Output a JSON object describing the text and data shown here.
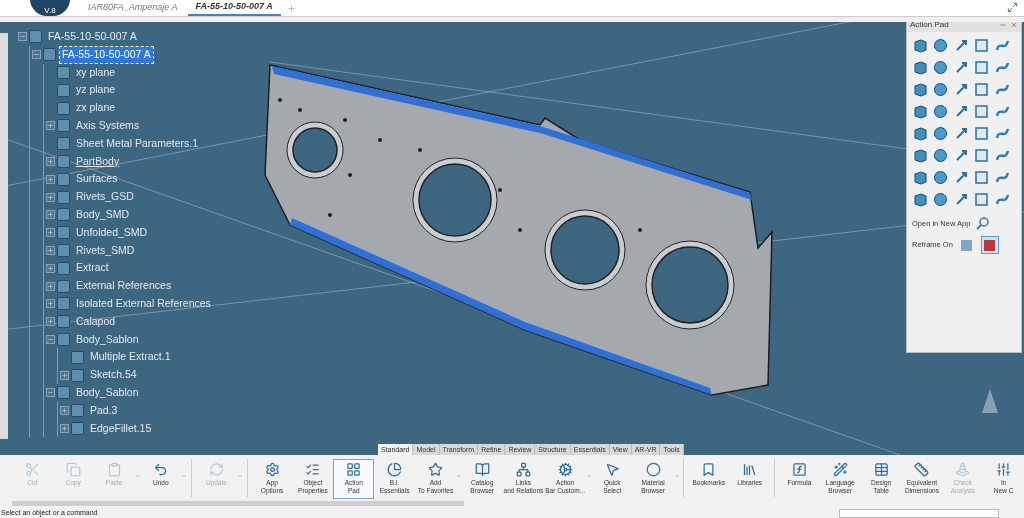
{
  "logo": {
    "text": "V.8"
  },
  "document_tabs": [
    {
      "label": "IAR80FA_Ampenaje A",
      "selected": false
    },
    {
      "label": "FA-55-10-50-007 A",
      "selected": true
    }
  ],
  "tree": [
    {
      "label": "FA-55-10-50-007 A",
      "expanded": true,
      "selected": false,
      "in_work": false,
      "children": [
        {
          "label": "FA-55-10-50-007 A",
          "expanded": true,
          "selected": true,
          "in_work": false,
          "children": [
            {
              "label": "xy plane",
              "selected": false,
              "in_work": false
            },
            {
              "label": "yz plane",
              "selected": false,
              "in_work": false
            },
            {
              "label": "zx plane",
              "selected": false,
              "in_work": false
            },
            {
              "label": "Axis Systems",
              "expanded": false,
              "selected": false,
              "in_work": false
            },
            {
              "label": "Sheet Metal Parameters.1",
              "selected": false,
              "in_work": false
            },
            {
              "label": "PartBody",
              "expanded": false,
              "selected": false,
              "in_work": true
            },
            {
              "label": "Surfaces",
              "expanded": false,
              "selected": false,
              "in_work": false
            },
            {
              "label": "Rivets_GSD",
              "expanded": false,
              "selected": false,
              "in_work": false
            },
            {
              "label": "Body_SMD",
              "expanded": false,
              "selected": false,
              "in_work": false
            },
            {
              "label": "Unfolded_SMD",
              "expanded": false,
              "selected": false,
              "in_work": false
            },
            {
              "label": "Rivets_SMD",
              "expanded": false,
              "selected": false,
              "in_work": false
            },
            {
              "label": "Extract",
              "expanded": false,
              "selected": false,
              "in_work": false
            },
            {
              "label": "External References",
              "expanded": false,
              "selected": false,
              "in_work": false
            },
            {
              "label": "Isolated External References",
              "expanded": false,
              "selected": false,
              "in_work": false
            },
            {
              "label": "Calapod",
              "expanded": false,
              "selected": false,
              "in_work": false
            },
            {
              "label": "Body_Sablon",
              "expanded": true,
              "selected": false,
              "in_work": false,
              "children": [
                {
                  "label": "Multiple Extract.1",
                  "selected": false,
                  "in_work": false
                },
                {
                  "label": "Sketch.54",
                  "expanded": false,
                  "selected": false,
                  "in_work": false
                }
              ]
            },
            {
              "label": "Body_Sablon",
              "expanded": true,
              "selected": false,
              "in_work": false,
              "children": [
                {
                  "label": "Pad.3",
                  "expanded": false,
                  "selected": false,
                  "in_work": false
                },
                {
                  "label": "EdgeFillet.15",
                  "expanded": false,
                  "selected": false,
                  "in_work": false
                }
              ]
            }
          ]
        }
      ]
    }
  ],
  "action_pad": {
    "title": "Action Pad",
    "open_in_new_app": "Open in New App",
    "reframe_on": "Reframe On",
    "reframe_buttons": [
      {
        "selected": false
      },
      {
        "selected": true
      }
    ]
  },
  "section_tabs": [
    {
      "label": "Standard",
      "selected": true
    },
    {
      "label": "Model",
      "selected": false
    },
    {
      "label": "Transform",
      "selected": false
    },
    {
      "label": "Refine",
      "selected": false
    },
    {
      "label": "Review",
      "selected": false
    },
    {
      "label": "Structure",
      "selected": false
    },
    {
      "label": "Essentials",
      "selected": false
    },
    {
      "label": "View",
      "selected": false
    },
    {
      "label": "AR-VR",
      "selected": false
    },
    {
      "label": "Tools",
      "selected": false
    }
  ],
  "toolbar": [
    {
      "label": "Cut",
      "disabled": true,
      "selected": false
    },
    {
      "label": "Copy",
      "disabled": true,
      "selected": false
    },
    {
      "label": "Paste",
      "disabled": true,
      "selected": false,
      "dropdown": true
    },
    {
      "label": "Undo",
      "disabled": false,
      "selected": false,
      "dropdown": true,
      "separator": true
    },
    {
      "label": "Update",
      "disabled": true,
      "selected": false,
      "dropdown": true,
      "separator": true
    },
    {
      "label": "App\nOptions",
      "disabled": false,
      "selected": false
    },
    {
      "label": "Object\nProperties",
      "disabled": false,
      "selected": false
    },
    {
      "label": "Action\nPad",
      "disabled": false,
      "selected": true
    },
    {
      "label": "B.I.\nEssentials",
      "disabled": false,
      "selected": false
    },
    {
      "label": "Add\nTo Favorites",
      "disabled": false,
      "selected": false,
      "dropdown": true
    },
    {
      "label": "Catalog\nBrowser",
      "disabled": false,
      "selected": false
    },
    {
      "label": "Links\nand Relations",
      "disabled": false,
      "selected": false
    },
    {
      "label": "Action\nBar Custom...",
      "disabled": false,
      "selected": false,
      "dropdown": true
    },
    {
      "label": "Quick\nSelect",
      "disabled": false,
      "selected": false
    },
    {
      "label": "Material\nBrowser",
      "disabled": false,
      "selected": false,
      "dropdown": true,
      "separator": true
    },
    {
      "label": "Bookmarks",
      "disabled": false,
      "selected": false
    },
    {
      "label": "Libraries",
      "disabled": false,
      "selected": false,
      "separator": true
    },
    {
      "label": "Formula",
      "disabled": false,
      "selected": false
    },
    {
      "label": "Language\nBrowser",
      "disabled": false,
      "selected": false
    },
    {
      "label": "Design\nTable",
      "disabled": false,
      "selected": false
    },
    {
      "label": "Equivalent\nDimensions",
      "disabled": false,
      "selected": false
    },
    {
      "label": "Check\nAnalysis",
      "disabled": true,
      "selected": false
    },
    {
      "label": "In\nNew C",
      "disabled": false,
      "selected": false
    }
  ],
  "status_bar": {
    "message": "Select an object or a command"
  }
}
